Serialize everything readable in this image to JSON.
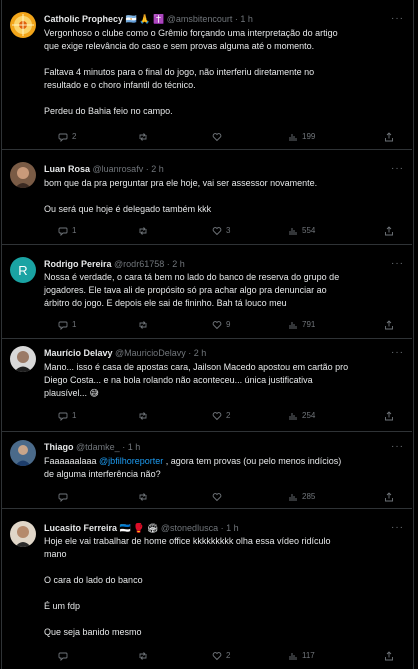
{
  "tweets": [
    {
      "name": "Catholic Prophecy",
      "badges": "🇦🇷 🙏 ✝️",
      "handle": "@amsbitencourt",
      "time": "1 h",
      "lines": [
        "Vergonhoso o clube como o Grêmio forçando uma interpretação do artigo",
        "que exige relevância do caso e sem provas alguma até o momento.",
        "",
        "Faltava 4 minutos para o final do jogo, não interferiu diretamente no",
        "resultado e o choro infantil do técnico.",
        "",
        "Perdeu do Bahia feio no campo."
      ],
      "replies": "2",
      "retweets": "",
      "likes": "",
      "views": "199"
    },
    {
      "name": "Luan Rosa",
      "badges": "",
      "handle": "@luanrosafv",
      "time": "2 h",
      "lines": [
        "bom que da pra perguntar pra ele hoje, vai ser assessor novamente.",
        "",
        "Ou será que hoje é delegado também kkk"
      ],
      "replies": "1",
      "retweets": "",
      "likes": "3",
      "views": "554"
    },
    {
      "name": "Rodrigo Pereira",
      "badges": "",
      "handle": "@rodr61758",
      "time": "2 h",
      "lines": [
        "Nossa é verdade, o cara tá bem no lado do banco de reserva do grupo de",
        "jogadores. Ele tava ali de propósito só pra achar algo pra denunciar ao",
        "árbitro do jogo. E depois ele sai de fininho. Bah tá louco meu"
      ],
      "replies": "1",
      "retweets": "",
      "likes": "9",
      "views": "791"
    },
    {
      "name": "Maurício Delavy",
      "badges": "",
      "handle": "@MauricioDelavy",
      "time": "2 h",
      "lines": [
        "Mano... isso é casa de apostas cara, Jailson Macedo apostou em cartão pro",
        "Diego Costa... e na bola rolando não aconteceu... única justificativa",
        "plausível... 😅"
      ],
      "replies": "1",
      "retweets": "",
      "likes": "2",
      "views": "254"
    },
    {
      "name": "Thiago",
      "badges": "",
      "handle": "@tdamke_",
      "time": "1 h",
      "line1_before": "Faaaaaalaaa ",
      "mention": "@jbfilhoreporter",
      "line1_after": " , agora tem provas (ou pelo menos indícios)",
      "lines": [
        "de alguma interferência não?"
      ],
      "replies": "",
      "retweets": "",
      "likes": "",
      "views": "285"
    },
    {
      "name": "Lucasito Ferreira",
      "badges": "🇪🇪 🥊 🏟",
      "handle": "@stonedlusca",
      "time": "1 h",
      "lines": [
        "Hoje ele vai trabalhar de home office kkkkkkkkk olha essa vídeo ridículo",
        "mano",
        "",
        "O cara do lado do banco",
        "",
        "É um fdp",
        "",
        "Que seja banido mesmo"
      ],
      "replies": "",
      "retweets": "",
      "likes": "2",
      "views": "117"
    }
  ],
  "avatars": {
    "r_letter": "R"
  },
  "colors": {
    "background": "#000000",
    "text": "#e7e9ea",
    "muted": "#71767b",
    "link": "#1d9bf0",
    "divider": "#2f3336"
  }
}
